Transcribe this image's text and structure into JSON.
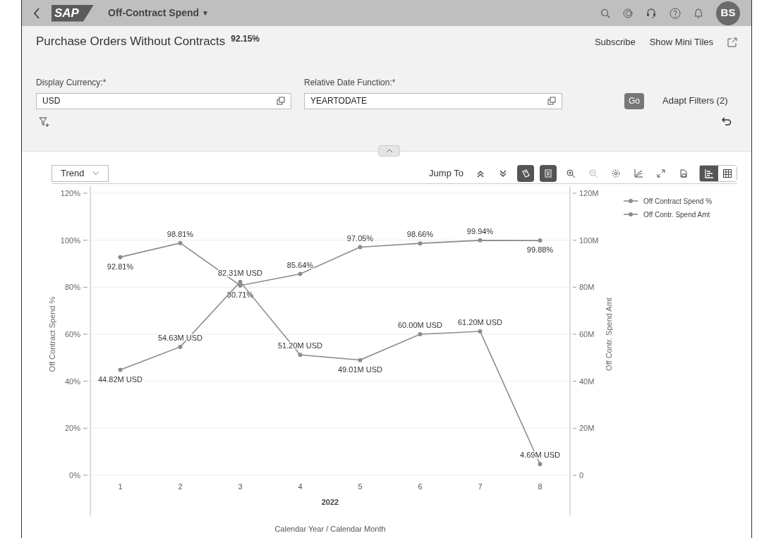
{
  "shell": {
    "logo": "SAP",
    "title": "Off-Contract Spend",
    "title_caret": "▼",
    "avatar": "BS"
  },
  "header": {
    "title": "Purchase Orders Without Contracts",
    "kpi": "92.15%",
    "actions": [
      "Subscribe",
      "Show Mini Tiles"
    ]
  },
  "filters": [
    {
      "label": "Display Currency:*",
      "value": "USD"
    },
    {
      "label": "Relative Date Function:*",
      "value": "YEARTODATE"
    }
  ],
  "filter_actions": {
    "go": "Go",
    "adapt": "Adapt Filters (2)"
  },
  "toolbar": {
    "view": "Trend",
    "jump_to": "Jump To",
    "buttons": [
      {
        "kind": "up",
        "selected": false,
        "disabled": false
      },
      {
        "kind": "down",
        "selected": false,
        "disabled": false
      },
      {
        "kind": "tag",
        "selected": true,
        "disabled": false
      },
      {
        "kind": "list",
        "selected": true,
        "disabled": false
      },
      {
        "kind": "zoomin",
        "selected": false,
        "disabled": false
      },
      {
        "kind": "zoomout",
        "selected": false,
        "disabled": true
      },
      {
        "kind": "gear",
        "selected": false,
        "disabled": false
      },
      {
        "kind": "lines",
        "selected": false,
        "disabled": false
      },
      {
        "kind": "expand",
        "selected": false,
        "disabled": false
      },
      {
        "kind": "doc",
        "selected": false,
        "disabled": false
      }
    ],
    "views": [
      {
        "kind": "chart",
        "selected": true
      },
      {
        "kind": "table",
        "selected": false
      }
    ]
  },
  "chart": {
    "x_group_label": "2022",
    "chart_data": {
      "type": "line",
      "xlabel": "Calendar Year / Calendar Month",
      "ylabel": "Off Contract Spend %",
      "y2label": "Off Contr. Spend Amt",
      "categories": [
        "1",
        "2",
        "3",
        "4",
        "5",
        "6",
        "7",
        "8"
      ],
      "grid": true,
      "legend": "right",
      "ylim": [
        0,
        120
      ],
      "y2lim": [
        0,
        120
      ],
      "yticks": [
        {
          "value": 0,
          "label": "0%"
        },
        {
          "value": 20,
          "label": "20%"
        },
        {
          "value": 40,
          "label": "40%"
        },
        {
          "value": 60,
          "label": "60%"
        },
        {
          "value": 80,
          "label": "80%"
        },
        {
          "value": 100,
          "label": "100%"
        },
        {
          "value": 120,
          "label": "120%"
        }
      ],
      "y2ticks": [
        {
          "value": 0,
          "label": "0"
        },
        {
          "value": 20,
          "label": "20M"
        },
        {
          "value": 40,
          "label": "40M"
        },
        {
          "value": 60,
          "label": "60M"
        },
        {
          "value": 80,
          "label": "80M"
        },
        {
          "value": 100,
          "label": "100M"
        },
        {
          "value": 120,
          "label": "120M"
        }
      ],
      "series": [
        {
          "name": "Off Contract Spend %",
          "color": "#8c8c8c",
          "marker": "circle",
          "values": [
            92.81,
            98.81,
            80.71,
            85.64,
            97.05,
            98.66,
            99.94,
            99.88
          ],
          "value_labels": [
            "92.81%",
            "98.81%",
            "80.71%",
            "85.64%",
            "97.05%",
            "98.66%",
            "99.94%",
            "99.88%"
          ]
        },
        {
          "name": "Off Contr. Spend Amt",
          "color": "#8c8c8c",
          "marker": "circle",
          "axis": "y2",
          "values": [
            44.82,
            54.63,
            82.31,
            51.2,
            49.01,
            60.0,
            61.2,
            4.69
          ],
          "value_labels": [
            "44.82M USD",
            "54.63M USD",
            "82.31M USD",
            "51.20M USD",
            "49.01M USD",
            "60.00M USD",
            "61.20M USD",
            "4.69M USD"
          ]
        }
      ]
    }
  }
}
